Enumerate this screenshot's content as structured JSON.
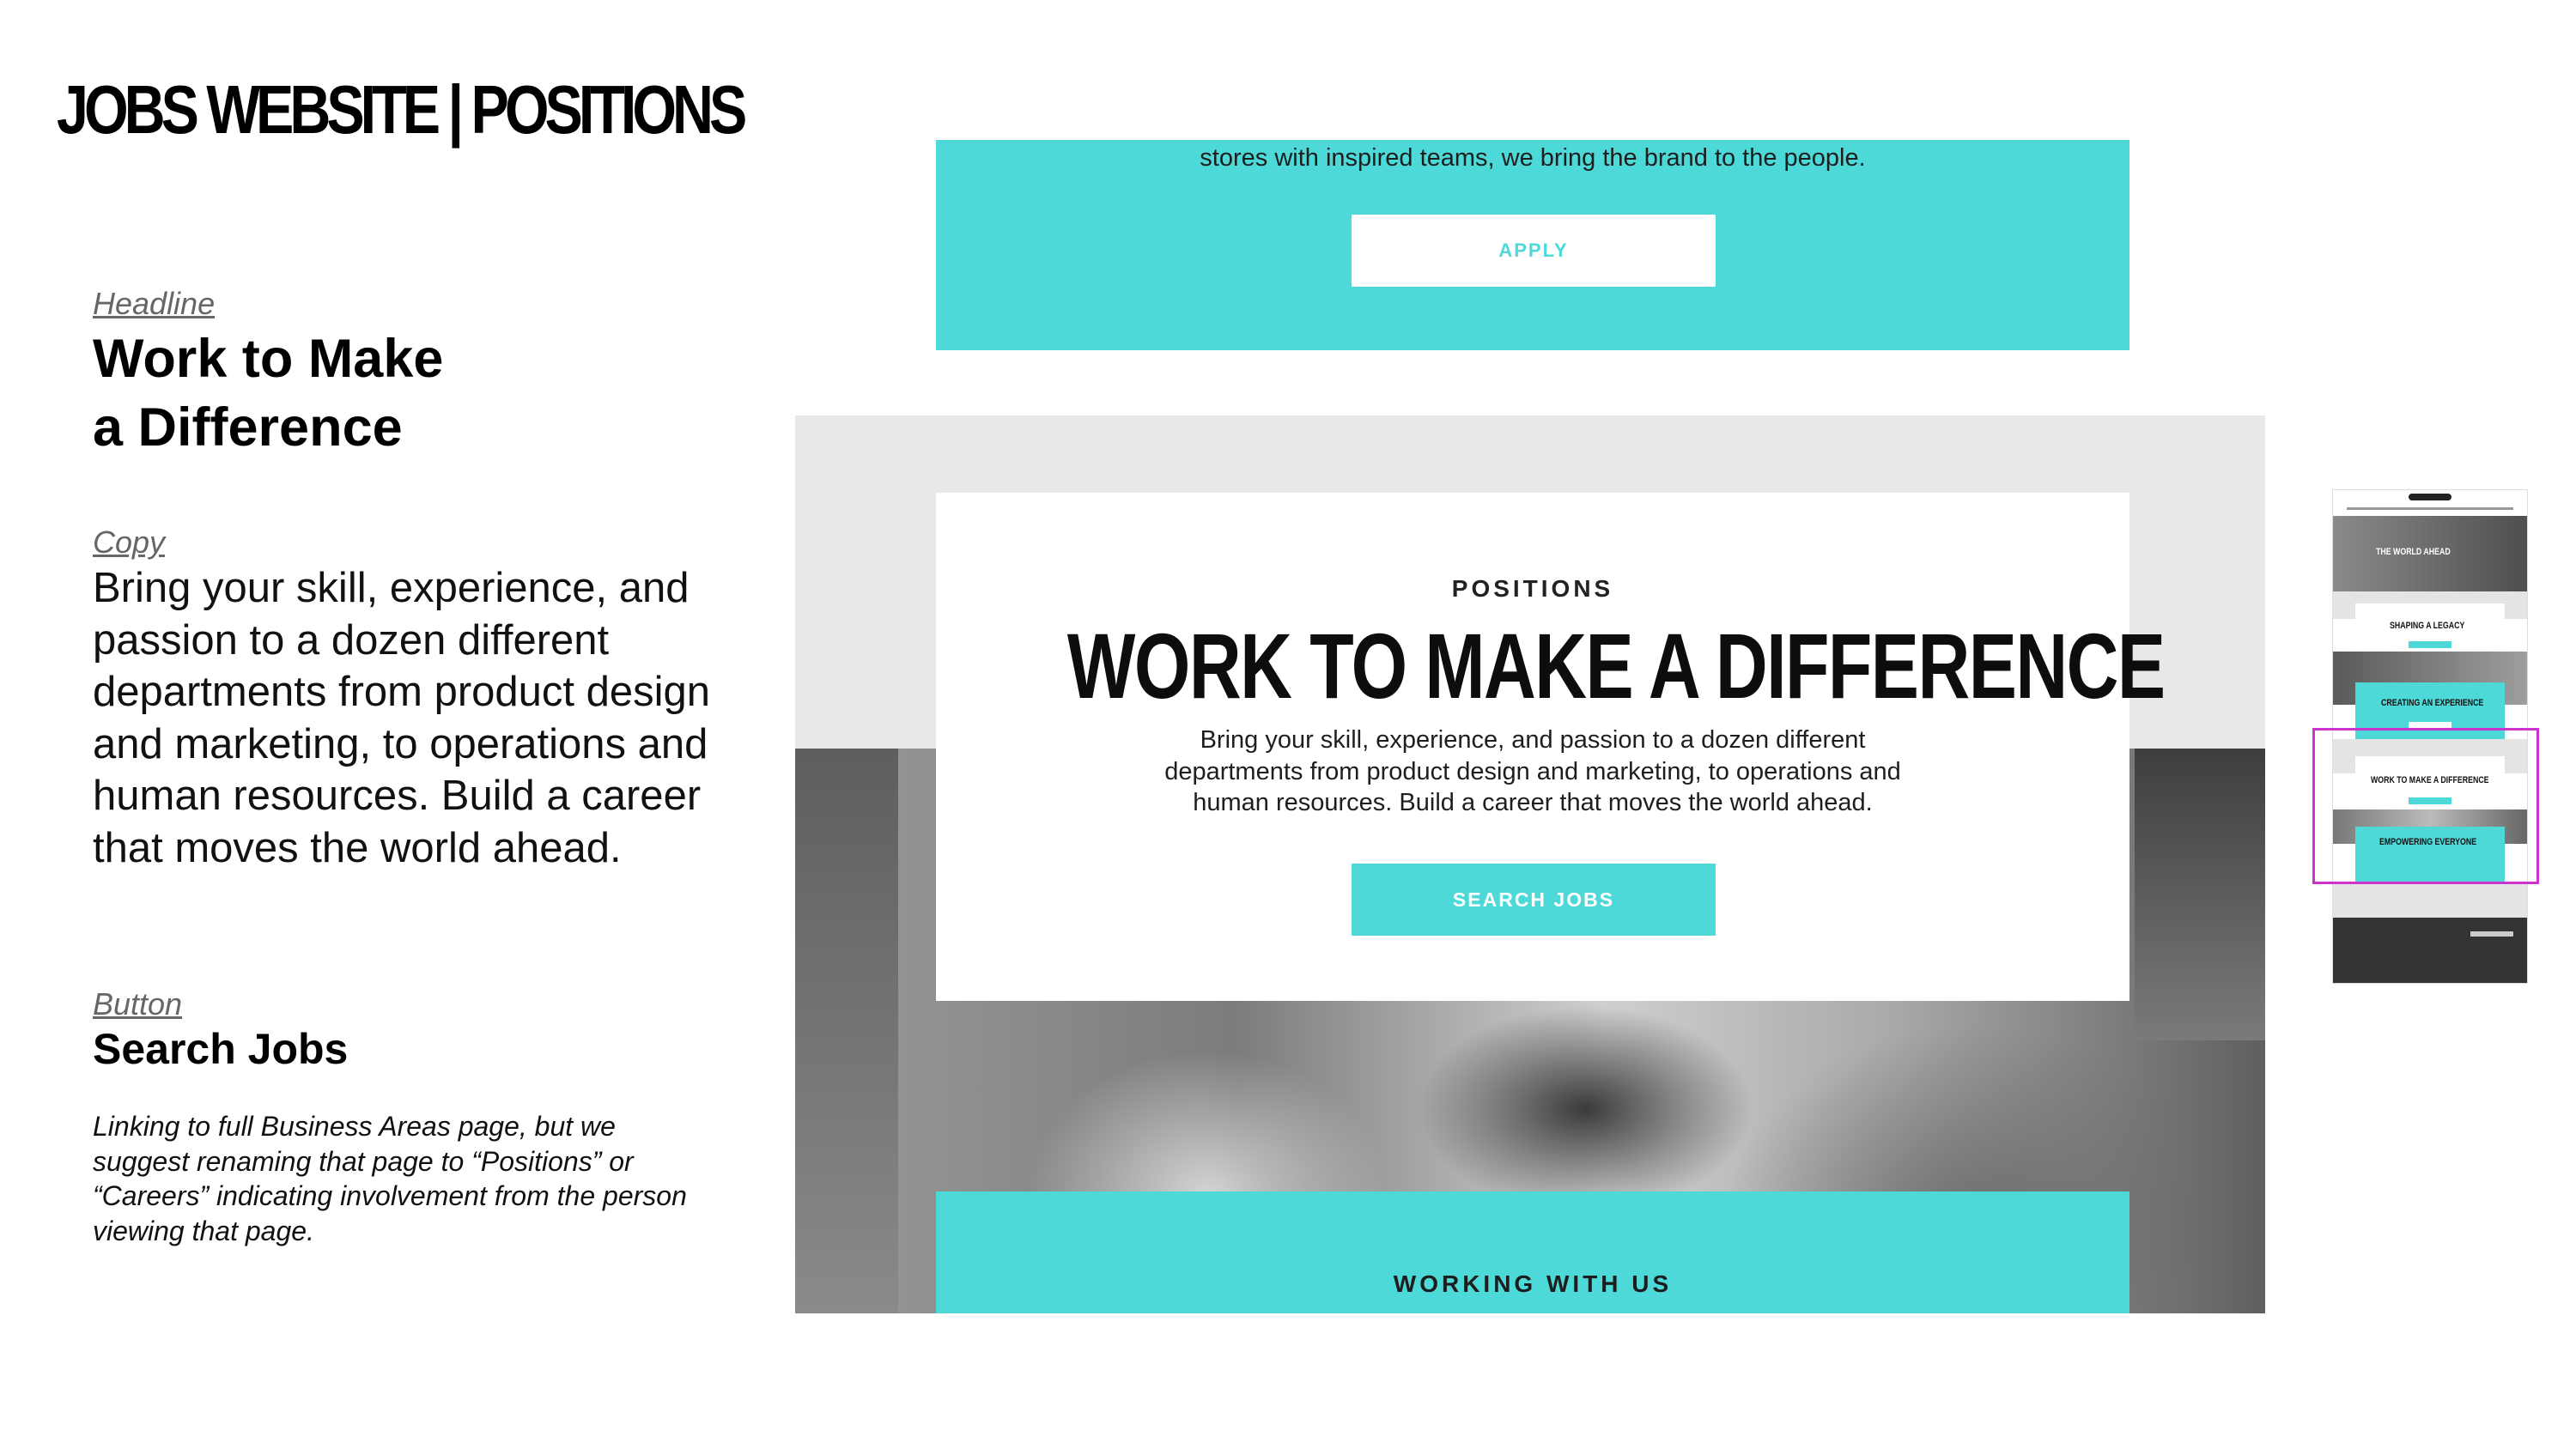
{
  "slide": {
    "title": "JOBS WEBSITE | POSITIONS"
  },
  "annotations": {
    "headline_label": "Headline",
    "headline_line1": "Work to Make",
    "headline_line2": "a Difference",
    "copy_label": "Copy",
    "copy_text": "Bring your skill, experience, and passion to a dozen different departments from product design and marketing, to operations and human resources. Build a career that moves the world ahead.",
    "button_label": "Button",
    "button_value": "Search Jobs",
    "note": "Linking to full Business Areas page, but we suggest renaming that page to “Positions” or “Careers” indicating involvement from the person viewing that page."
  },
  "mockup": {
    "top_band_text": "stores with inspired teams, we bring the brand to the people.",
    "apply_label": "APPLY",
    "eyebrow": "POSITIONS",
    "title": "WORK TO MAKE A DIFFERENCE",
    "body": "Bring your skill, experience, and passion to a dozen different departments from product design and marketing, to operations and human resources. Build a career that moves the world ahead.",
    "search_label": "SEARCH JOBS",
    "working_label": "WORKING WITH US"
  },
  "thumbnail": {
    "hero_text": "THE WORLD AHEAD",
    "section1": "SHAPING A LEGACY",
    "section2": "CREATING AN EXPERIENCE",
    "section3": "WORK TO MAKE A DIFFERENCE",
    "section4": "EMPOWERING EVERYONE"
  },
  "colors": {
    "teal": "#4ed9d9",
    "highlight": "#cc33cc"
  }
}
